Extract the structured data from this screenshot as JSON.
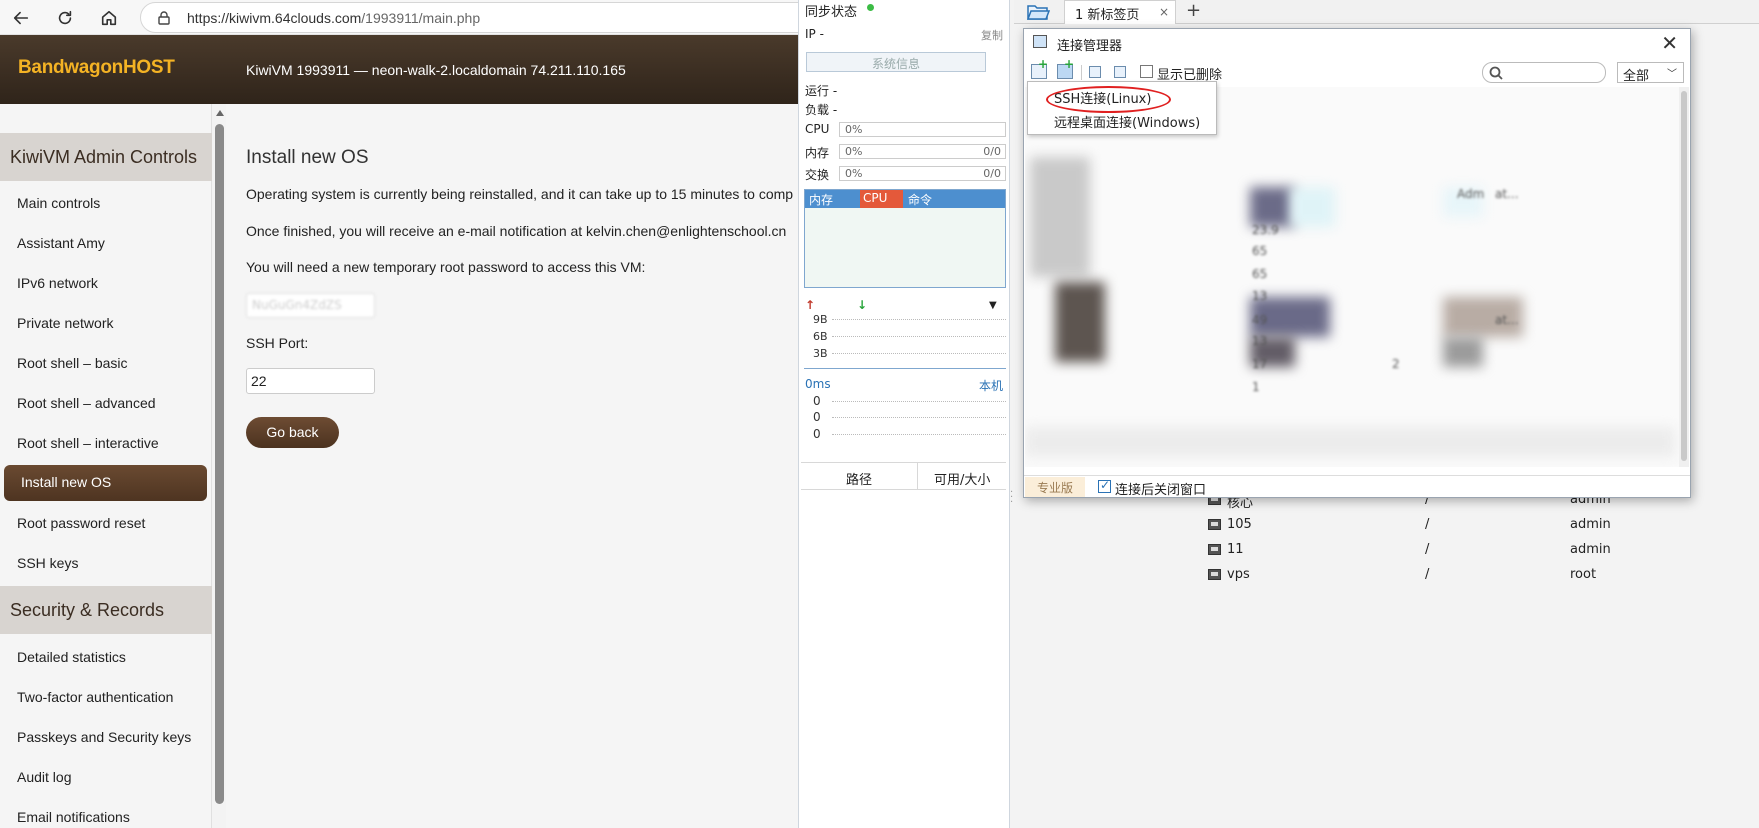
{
  "browser": {
    "url_host": "https://kiwivm.64clouds.com",
    "url_path": "/1993911/main.php"
  },
  "header": {
    "logo": "BandwagonHOST",
    "vm_title": "KiwiVM 1993911 — neon-walk-2.localdomain   74.211.110.165"
  },
  "sidebar": {
    "section1": "KiwiVM Admin Controls",
    "items1": [
      "Main controls",
      "Assistant Amy",
      "IPv6 network",
      "Private network",
      "Root shell – basic",
      "Root shell – advanced",
      "Root shell – interactive",
      "Install new OS",
      "Root password reset",
      "SSH keys"
    ],
    "section2": "Security & Records",
    "items2": [
      "Detailed statistics",
      "Two-factor authentication",
      "Passkeys and Security keys",
      "Audit log",
      "Email notifications"
    ]
  },
  "main": {
    "title": "Install new OS",
    "line1": "Operating system is currently being reinstalled, and it can take up to 15 minutes to comp",
    "line2": "Once finished, you will receive an e-mail notification at kelvin.chen@enlightenschool.cn",
    "line3": "You will need a new temporary root password to access this VM:",
    "password_value": "NuGuGn4ZdZS",
    "ssh_port_label": "SSH Port:",
    "ssh_port_value": "22",
    "go_back": "Go back"
  },
  "monitor": {
    "sync_status": "同步状态",
    "ip_label": "IP   -",
    "copy": "复制",
    "sysinfo": "系统信息",
    "run": "运行 -",
    "load": "负载 -",
    "cpu_label": "CPU",
    "cpu_value": "0%",
    "mem_label": "内存",
    "mem_value": "0%",
    "mem_right": "0/0",
    "swap_label": "交换",
    "swap_value": "0%",
    "swap_right": "0/0",
    "proc_cols": [
      "内存",
      "CPU",
      "命令"
    ],
    "net_labels": [
      "9B",
      "6B",
      "3B"
    ],
    "ping": "0ms",
    "local": "本机",
    "ping_vals": [
      "0",
      "0",
      "0"
    ],
    "path_col": "路径",
    "size_col": "可用/大小"
  },
  "tabs": {
    "tab1": "1 新标签页",
    "close": "×",
    "add": "+"
  },
  "session_list": [
    {
      "name": "核心",
      "path": "/",
      "user": "admin"
    },
    {
      "name": "105",
      "path": "/",
      "user": "admin"
    },
    {
      "name": "11",
      "path": "/",
      "user": "admin"
    },
    {
      "name": "vps",
      "path": "/",
      "user": "root"
    }
  ],
  "dialog": {
    "title": "连接管理器",
    "close": "✕",
    "show_deleted": "显示已删除",
    "filter_value": "全部",
    "menu_ssh": "SSH连接(Linux)",
    "menu_rdp": "远程桌面连接(Windows)",
    "pro": "专业版",
    "close_after_connect": "连接后关闭窗口",
    "blurred": [
      "23.9",
      "65",
      "65",
      "13",
      "49",
      "13",
      "17",
      "1",
      "2",
      "Adm",
      "at...",
      "at..."
    ]
  },
  "colors": {
    "accent_brown": "#5a3d28",
    "logo_gold": "#f4b324",
    "highlight_red": "#e02020",
    "blue": "#4d8fcf"
  }
}
